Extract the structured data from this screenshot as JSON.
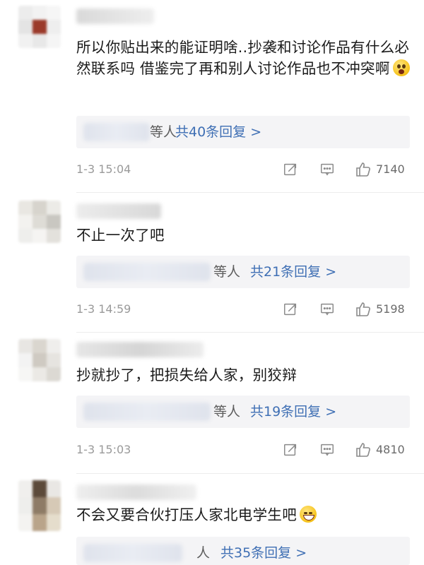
{
  "comments": [
    {
      "text": "所以你贴出来的能证明啥..抄袭和讨论作品有什么必然联系吗 借鉴完了再和别人讨论作品也不冲突啊",
      "emoji": "flushed-face-icon",
      "reply_tail": "等人",
      "reply_count": "共40条回复 >",
      "time": "1-3 15:04",
      "likes": "7140"
    },
    {
      "text": "不止一次了吧",
      "reply_tail": "等人",
      "reply_count": "共21条回复 >",
      "time": "1-3 14:59",
      "likes": "5198"
    },
    {
      "text": "抄就抄了，把损失给人家，别狡辩",
      "reply_tail": "等人",
      "reply_count": "共19条回复 >",
      "time": "1-3 15:03",
      "likes": "4810"
    },
    {
      "text": "不会又要合伙打压人家北电学生吧",
      "emoji": "sweat-smile-icon",
      "reply_tail": "人",
      "reply_count": "共35条回复 >"
    }
  ],
  "colors": {
    "link": "#3f6fb4",
    "meta": "#9a9a9a",
    "reply_bg": "#f4f4f6"
  }
}
